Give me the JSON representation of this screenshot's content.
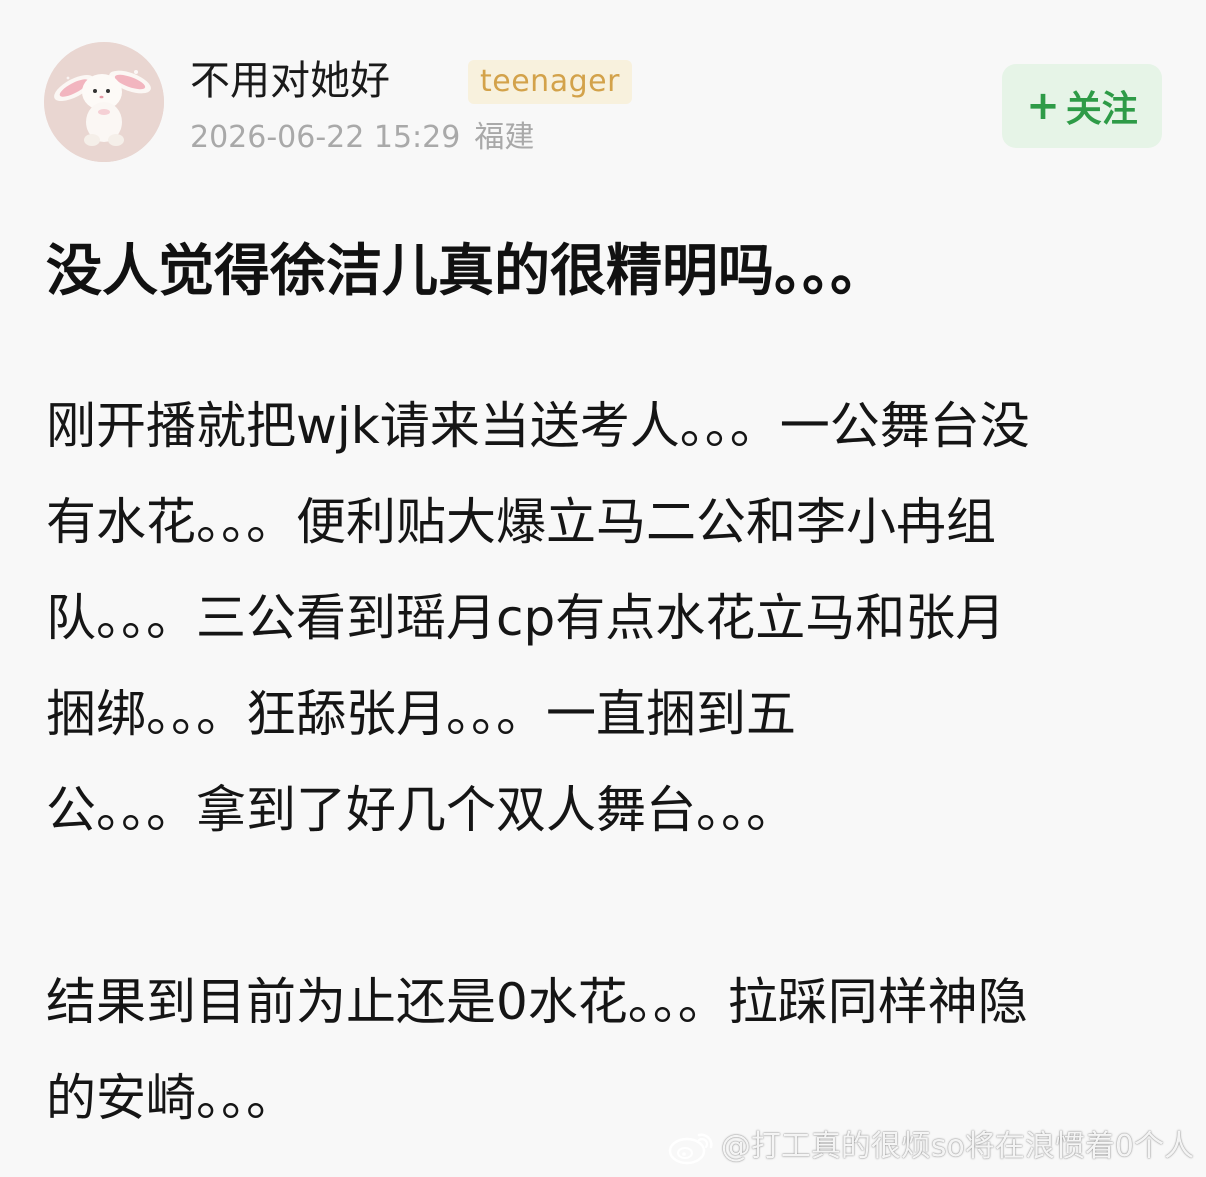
{
  "header": {
    "avatar": "plush-bunny-avatar",
    "username": "不用对她好",
    "badge": "teenager",
    "timestamp": "2026-06-22 15:29",
    "location": "福建",
    "follow_plus": "+",
    "follow_label": "关注"
  },
  "post": {
    "title": "没人觉得徐洁儿真的很精明吗。。。",
    "paragraphs": [
      [
        "刚开播就把wjk请来当送考人。。。一公舞台没",
        "有水花。。。便利贴大爆立马二公和李小冉组",
        "队。。。三公看到瑶月cp有点水花立马和张月",
        "捆绑。。。狂舔张月。。。一直捆到五",
        "公。。。拿到了好几个双人舞台。。。"
      ],
      [
        "结果到目前为止还是0水花。。。拉踩同样神隐",
        "的安崎。。。"
      ]
    ]
  },
  "watermark": {
    "icon": "weibo-icon",
    "text": "@打工真的很烦so将在浪惯着0个人"
  },
  "colors": {
    "background": "#f8f8f8",
    "follow_green": "#2e9b47",
    "follow_bg": "#e6f4e7",
    "badge_gold": "#d3a24a",
    "badge_bg": "#f8f1dd",
    "meta_gray": "#a9a9a9"
  }
}
